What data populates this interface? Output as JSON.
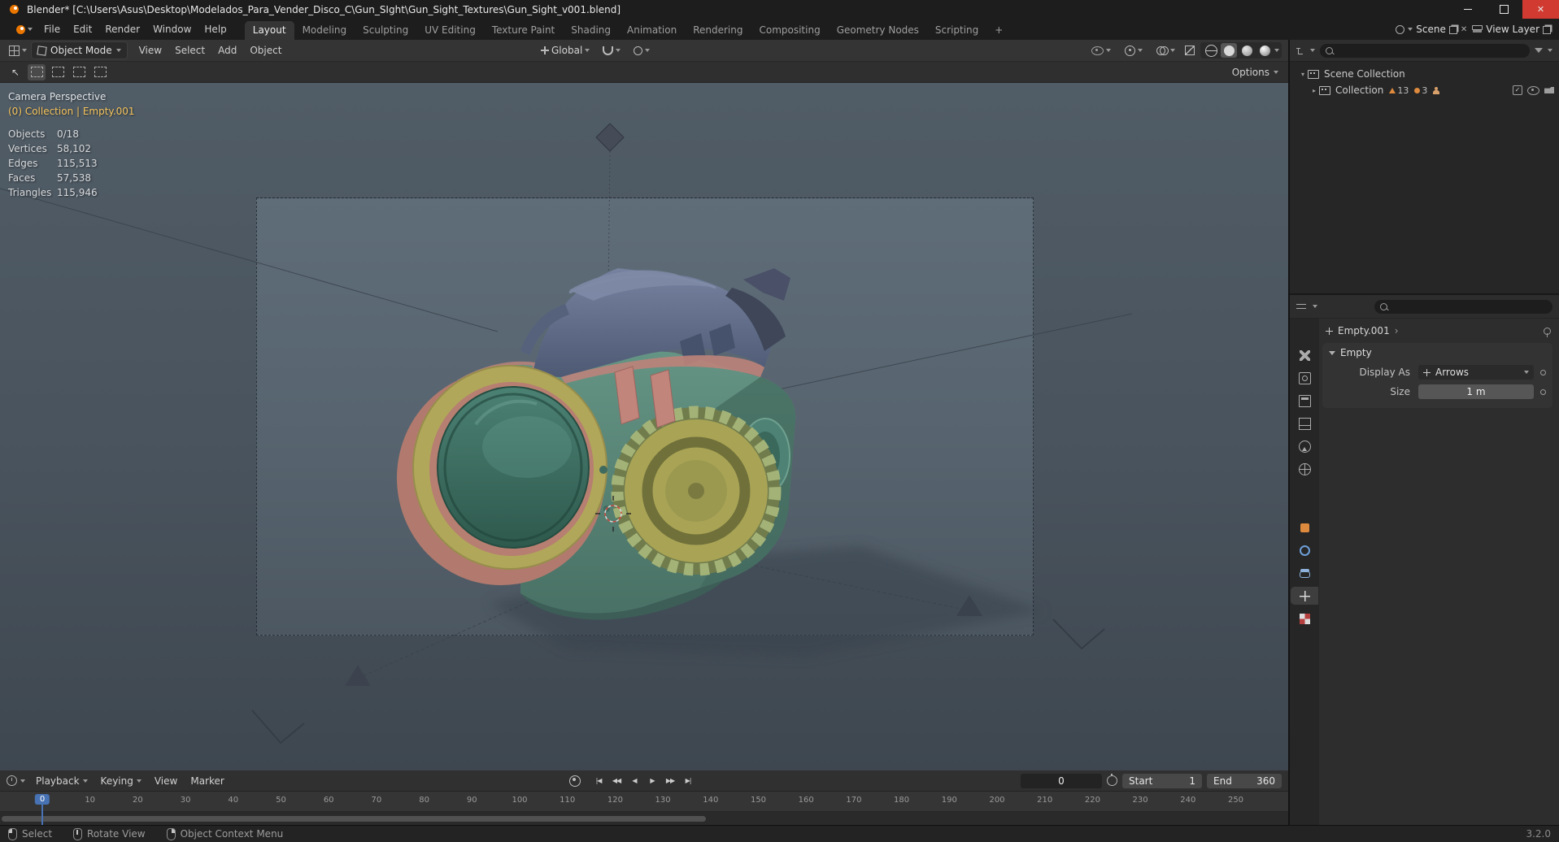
{
  "window": {
    "title": "Blender* [C:\\Users\\Asus\\Desktop\\Modelados_Para_Vender_Disco_C\\Gun_SIght\\Gun_Sight_Textures\\Gun_Sight_v001.blend]"
  },
  "topbar": {
    "menus": [
      {
        "label": "File"
      },
      {
        "label": "Edit"
      },
      {
        "label": "Render"
      },
      {
        "label": "Window"
      },
      {
        "label": "Help"
      }
    ],
    "tabs": [
      {
        "label": "Layout",
        "active": true
      },
      {
        "label": "Modeling"
      },
      {
        "label": "Sculpting"
      },
      {
        "label": "UV Editing"
      },
      {
        "label": "Texture Paint"
      },
      {
        "label": "Shading"
      },
      {
        "label": "Animation"
      },
      {
        "label": "Rendering"
      },
      {
        "label": "Compositing"
      },
      {
        "label": "Geometry Nodes"
      },
      {
        "label": "Scripting"
      },
      {
        "label": "+"
      }
    ],
    "scene_label": "Scene",
    "view_layer_label": "View Layer"
  },
  "viewport": {
    "header": {
      "mode": "Object Mode",
      "menus": [
        {
          "label": "View"
        },
        {
          "label": "Select"
        },
        {
          "label": "Add"
        },
        {
          "label": "Object"
        }
      ],
      "orientation": "Global"
    },
    "tool_row": {
      "options_label": "Options"
    },
    "overlay": {
      "view_label": "Camera Perspective",
      "context": "(0) Collection | Empty.001",
      "stats": [
        {
          "label": "Objects",
          "value": "0/18"
        },
        {
          "label": "Vertices",
          "value": "58,102"
        },
        {
          "label": "Edges",
          "value": "115,513"
        },
        {
          "label": "Faces",
          "value": "57,538"
        },
        {
          "label": "Triangles",
          "value": "115,946"
        }
      ]
    }
  },
  "outliner": {
    "scene_collection_label": "Scene Collection",
    "collection_label": "Collection",
    "counts": {
      "meshes": "13",
      "others": "3"
    }
  },
  "properties": {
    "breadcrumb": "Empty.001",
    "breadcrumb_sep": "›",
    "panel_title": "Empty",
    "display_as_label": "Display As",
    "display_as_value": "Arrows",
    "size_label": "Size",
    "size_value": "1 m"
  },
  "timeline": {
    "menus": [
      {
        "label": "Playback"
      },
      {
        "label": "Keying"
      },
      {
        "label": "View"
      },
      {
        "label": "Marker"
      }
    ],
    "transport": [
      {
        "glyph": "|◀"
      },
      {
        "glyph": "◀◀"
      },
      {
        "glyph": "◀"
      },
      {
        "glyph": "▶"
      },
      {
        "glyph": "▶▶"
      },
      {
        "glyph": "▶|"
      }
    ],
    "current_frame": "0",
    "start_label": "Start",
    "start_value": "1",
    "end_label": "End",
    "end_value": "360",
    "ruler": [
      0,
      10,
      20,
      30,
      40,
      50,
      60,
      70,
      80,
      90,
      100,
      110,
      120,
      130,
      140,
      150,
      160,
      170,
      180,
      190,
      200,
      210,
      220,
      230,
      240,
      250
    ]
  },
  "status": {
    "hints": [
      {
        "label": "Select"
      },
      {
        "label": "Rotate View"
      },
      {
        "label": "Object Context Menu"
      }
    ],
    "version": "3.2.0"
  },
  "colors": {
    "accent": "#4772b3",
    "active_object_text": "#f5c35c",
    "object_orange": "#dd8a3e"
  }
}
